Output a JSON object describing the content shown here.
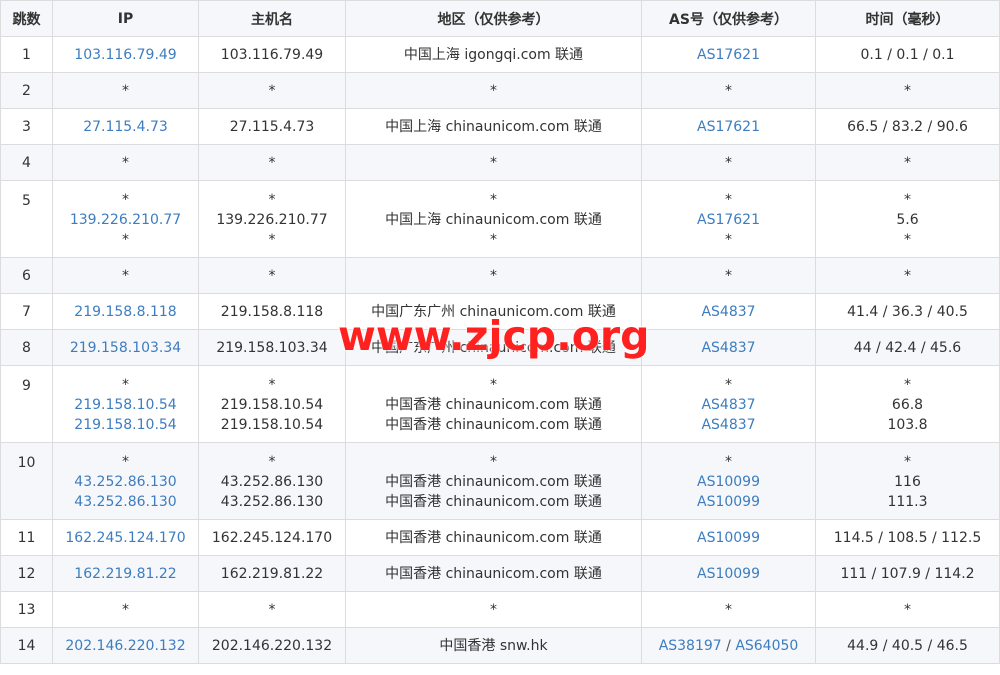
{
  "headers": [
    "跳数",
    "IP",
    "主机名",
    "地区（仅供参考）",
    "AS号（仅供参考）",
    "时间（毫秒）"
  ],
  "watermark": "www.zjcp.org",
  "rows": [
    {
      "hop": "1",
      "ip": [
        "103.116.79.49"
      ],
      "host": [
        "103.116.79.49"
      ],
      "region": [
        "中国上海 igongqi.com 联通"
      ],
      "as": [
        [
          "AS17621"
        ]
      ],
      "time": [
        "0.1 / 0.1 / 0.1"
      ]
    },
    {
      "hop": "2",
      "ip": [
        "*"
      ],
      "host": [
        "*"
      ],
      "region": [
        "*"
      ],
      "as": [
        [
          "*"
        ]
      ],
      "time": [
        "*"
      ]
    },
    {
      "hop": "3",
      "ip": [
        "27.115.4.73"
      ],
      "host": [
        "27.115.4.73"
      ],
      "region": [
        "中国上海 chinaunicom.com 联通"
      ],
      "as": [
        [
          "AS17621"
        ]
      ],
      "time": [
        "66.5 / 83.2 / 90.6"
      ]
    },
    {
      "hop": "4",
      "ip": [
        "*"
      ],
      "host": [
        "*"
      ],
      "region": [
        "*"
      ],
      "as": [
        [
          "*"
        ]
      ],
      "time": [
        "*"
      ]
    },
    {
      "hop": "5",
      "ip": [
        "*",
        "139.226.210.77",
        "*"
      ],
      "host": [
        "*",
        "139.226.210.77",
        "*"
      ],
      "region": [
        "*",
        "中国上海 chinaunicom.com 联通",
        "*"
      ],
      "as": [
        [
          "*"
        ],
        [
          "AS17621"
        ],
        [
          "*"
        ]
      ],
      "time": [
        "*",
        "5.6",
        "*"
      ]
    },
    {
      "hop": "6",
      "ip": [
        "*"
      ],
      "host": [
        "*"
      ],
      "region": [
        "*"
      ],
      "as": [
        [
          "*"
        ]
      ],
      "time": [
        "*"
      ]
    },
    {
      "hop": "7",
      "ip": [
        "219.158.8.118"
      ],
      "host": [
        "219.158.8.118"
      ],
      "region": [
        "中国广东广州 chinaunicom.com 联通"
      ],
      "as": [
        [
          "AS4837"
        ]
      ],
      "time": [
        "41.4 / 36.3 / 40.5"
      ]
    },
    {
      "hop": "8",
      "ip": [
        "219.158.103.34"
      ],
      "host": [
        "219.158.103.34"
      ],
      "region": [
        "中国广东广州 chinaunicom.com 联通"
      ],
      "as": [
        [
          "AS4837"
        ]
      ],
      "time": [
        "44 / 42.4 / 45.6"
      ]
    },
    {
      "hop": "9",
      "ip": [
        "*",
        "219.158.10.54",
        "219.158.10.54"
      ],
      "host": [
        "*",
        "219.158.10.54",
        "219.158.10.54"
      ],
      "region": [
        "*",
        "中国香港 chinaunicom.com 联通",
        "中国香港 chinaunicom.com 联通"
      ],
      "as": [
        [
          "*"
        ],
        [
          "AS4837"
        ],
        [
          "AS4837"
        ]
      ],
      "time": [
        "*",
        "66.8",
        "103.8"
      ]
    },
    {
      "hop": "10",
      "ip": [
        "*",
        "43.252.86.130",
        "43.252.86.130"
      ],
      "host": [
        "*",
        "43.252.86.130",
        "43.252.86.130"
      ],
      "region": [
        "*",
        "中国香港 chinaunicom.com 联通",
        "中国香港 chinaunicom.com 联通"
      ],
      "as": [
        [
          "*"
        ],
        [
          "AS10099"
        ],
        [
          "AS10099"
        ]
      ],
      "time": [
        "*",
        "116",
        "111.3"
      ]
    },
    {
      "hop": "11",
      "ip": [
        "162.245.124.170"
      ],
      "host": [
        "162.245.124.170"
      ],
      "region": [
        "中国香港 chinaunicom.com 联通"
      ],
      "as": [
        [
          "AS10099"
        ]
      ],
      "time": [
        "114.5 / 108.5 / 112.5"
      ]
    },
    {
      "hop": "12",
      "ip": [
        "162.219.81.22"
      ],
      "host": [
        "162.219.81.22"
      ],
      "region": [
        "中国香港 chinaunicom.com 联通"
      ],
      "as": [
        [
          "AS10099"
        ]
      ],
      "time": [
        "111 / 107.9 / 114.2"
      ]
    },
    {
      "hop": "13",
      "ip": [
        "*"
      ],
      "host": [
        "*"
      ],
      "region": [
        "*"
      ],
      "as": [
        [
          "*"
        ]
      ],
      "time": [
        "*"
      ]
    },
    {
      "hop": "14",
      "ip": [
        "202.146.220.132"
      ],
      "host": [
        "202.146.220.132"
      ],
      "region": [
        "中国香港 snw.hk"
      ],
      "as": [
        [
          "AS38197",
          "AS64050"
        ]
      ],
      "time": [
        "44.9 / 40.5 / 46.5"
      ]
    }
  ]
}
